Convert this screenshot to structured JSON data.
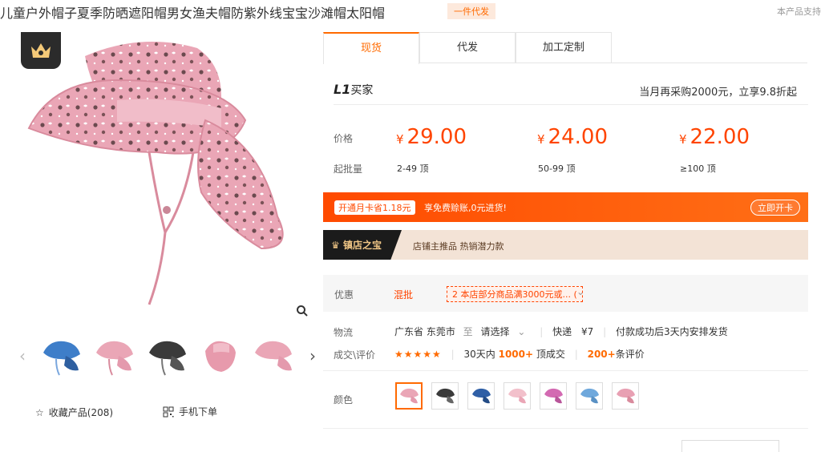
{
  "product": {
    "title": "儿童户外帽子夏季防晒遮阳帽男女渔夫帽防紫外线宝宝沙滩帽太阳帽",
    "tag": "一件代发",
    "right_note": "本产品支持"
  },
  "tabs": [
    {
      "label": "现货"
    },
    {
      "label": "代发"
    },
    {
      "label": "加工定制"
    }
  ],
  "buyer": {
    "level": "L1",
    "level_label": "买家",
    "promo": "当月再采购2000元，立享9.8折起"
  },
  "pricing": {
    "price_label": "价格",
    "moq_label": "起批量",
    "currency": "¥",
    "tiers": [
      {
        "price": "29.00",
        "range": "2-49 顶"
      },
      {
        "price": "24.00",
        "range": "50-99 顶"
      },
      {
        "price": "22.00",
        "range": "≥100 顶"
      }
    ]
  },
  "banner": {
    "save": "开通月卡省1.18元",
    "enjoy": "享免费赊账,0元进货!",
    "button": "立即开卡"
  },
  "treasure": {
    "title": "镇店之宝",
    "subtitle": "店铺主推品  热销潜力款"
  },
  "offer": {
    "label": "优惠",
    "mix": "混批",
    "coupon": "本店部分商品满3000元或...",
    "coupon_prefix": "2",
    "coupon_suffix": "("
  },
  "logistics": {
    "label": "物流",
    "origin": "广东省 东莞市",
    "to": "至",
    "dest": "请选择",
    "method": "快递",
    "fee": "¥7",
    "ship_note": "付款成功后3天内安排发货"
  },
  "deals": {
    "label": "成交\\评价",
    "stars": "★★★★★",
    "prefix": "30天内",
    "count": "1000+",
    "count_suffix": "顶成交",
    "reviews": "200+",
    "reviews_suffix": "条评价"
  },
  "color": {
    "label": "颜色"
  },
  "actions": {
    "favorite": "收藏产品(208)",
    "mobile": "手机下单"
  },
  "colors": {
    "accent": "#ff6a00",
    "price": "#ff4400",
    "hat_pink": "#e8a7b7"
  }
}
